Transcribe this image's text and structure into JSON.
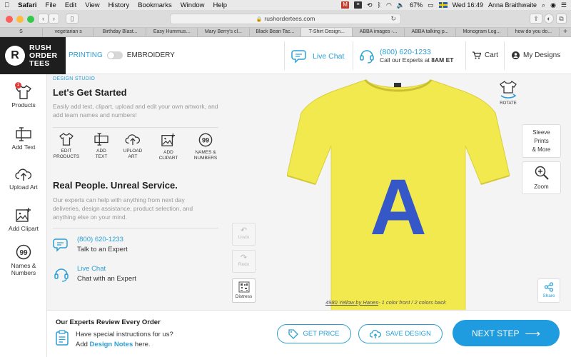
{
  "menubar": {
    "apple": "",
    "app": "Safari",
    "items": [
      "File",
      "Edit",
      "View",
      "History",
      "Bookmarks",
      "Window",
      "Help"
    ],
    "battery": "67%",
    "clock": "Wed 16:49",
    "user": "Anna Braithwaite"
  },
  "browser": {
    "url": "rushordertees.com",
    "tabs": [
      "S",
      "vegetarian s",
      "Birthday Blast...",
      "Easy Hummus...",
      "Mary Berry's cl...",
      "Black Bean Tac...",
      "T-Shirt Design...",
      "ABBA images -...",
      "ABBA talking p...",
      "Monogram Log...",
      "how do you do..."
    ],
    "active_tab": 6
  },
  "header": {
    "logo_line1": "RUSH",
    "logo_line2": "ORDER",
    "logo_line3": "TEES",
    "mode_printing": "PRINTING",
    "mode_embroidery": "EMBROIDERY",
    "live_chat": "Live Chat",
    "phone": "(800) 620-1233",
    "phone_sub_pre": "Call our Experts at ",
    "phone_sub_time": "8AM ET",
    "cart": "Cart",
    "my_designs": "My Designs"
  },
  "sidebar": {
    "products": "Products",
    "products_badge": "1",
    "add_text": "Add Text",
    "upload_art": "Upload Art",
    "add_clipart": "Add Clipart",
    "names_line1": "Names &",
    "names_line2": "Numbers"
  },
  "panel": {
    "studio_label": "DESIGN STUDIO",
    "start_title": "Let's Get Started",
    "start_desc": "Easily add text, clipart, upload and edit your own artwork, and add team names and numbers!",
    "tools": [
      {
        "l1": "EDIT",
        "l2": "PRODUCTS"
      },
      {
        "l1": "ADD",
        "l2": "TEXT"
      },
      {
        "l1": "UPLOAD",
        "l2": "ART"
      },
      {
        "l1": "ADD",
        "l2": "CLIPART"
      },
      {
        "l1": "NAMES &",
        "l2": "NUMBERS"
      }
    ],
    "real_title": "Real People. Unreal Service.",
    "real_desc": "Our experts can help with anything from next day deliveries, design assistance, product selection, and anything else on your mind.",
    "phone": "(800) 620-1233",
    "phone_sub": "Talk to an Expert",
    "chat": "Live Chat",
    "chat_sub": "Chat with an Expert"
  },
  "canvas": {
    "undo": "Undo",
    "redo": "Redo",
    "distress": "Distress",
    "shirt_letter": "A",
    "shirt_color": "#f2e94e",
    "letter_color": "#3557c8",
    "rotate": "ROTATE",
    "sleeve_l1": "Sleeve",
    "sleeve_l2": "Prints",
    "sleeve_l3": "& More",
    "zoom": "Zoom",
    "share": "Share",
    "product_link": "4980 Yellow by Hanes",
    "product_detail": "- 1 color front  /  2 colors back"
  },
  "bottom": {
    "review_title": "Our Experts Review Every Order",
    "review_line1": "Have special instructions for us?",
    "review_add": "Add ",
    "review_link": "Design Notes",
    "review_here": " here.",
    "get_price": "GET PRICE",
    "save_design": "SAVE DESIGN",
    "next_step": "NEXT STEP"
  },
  "colors": {
    "accent": "#2a9fd6",
    "primary_button": "#1f9ce0"
  }
}
